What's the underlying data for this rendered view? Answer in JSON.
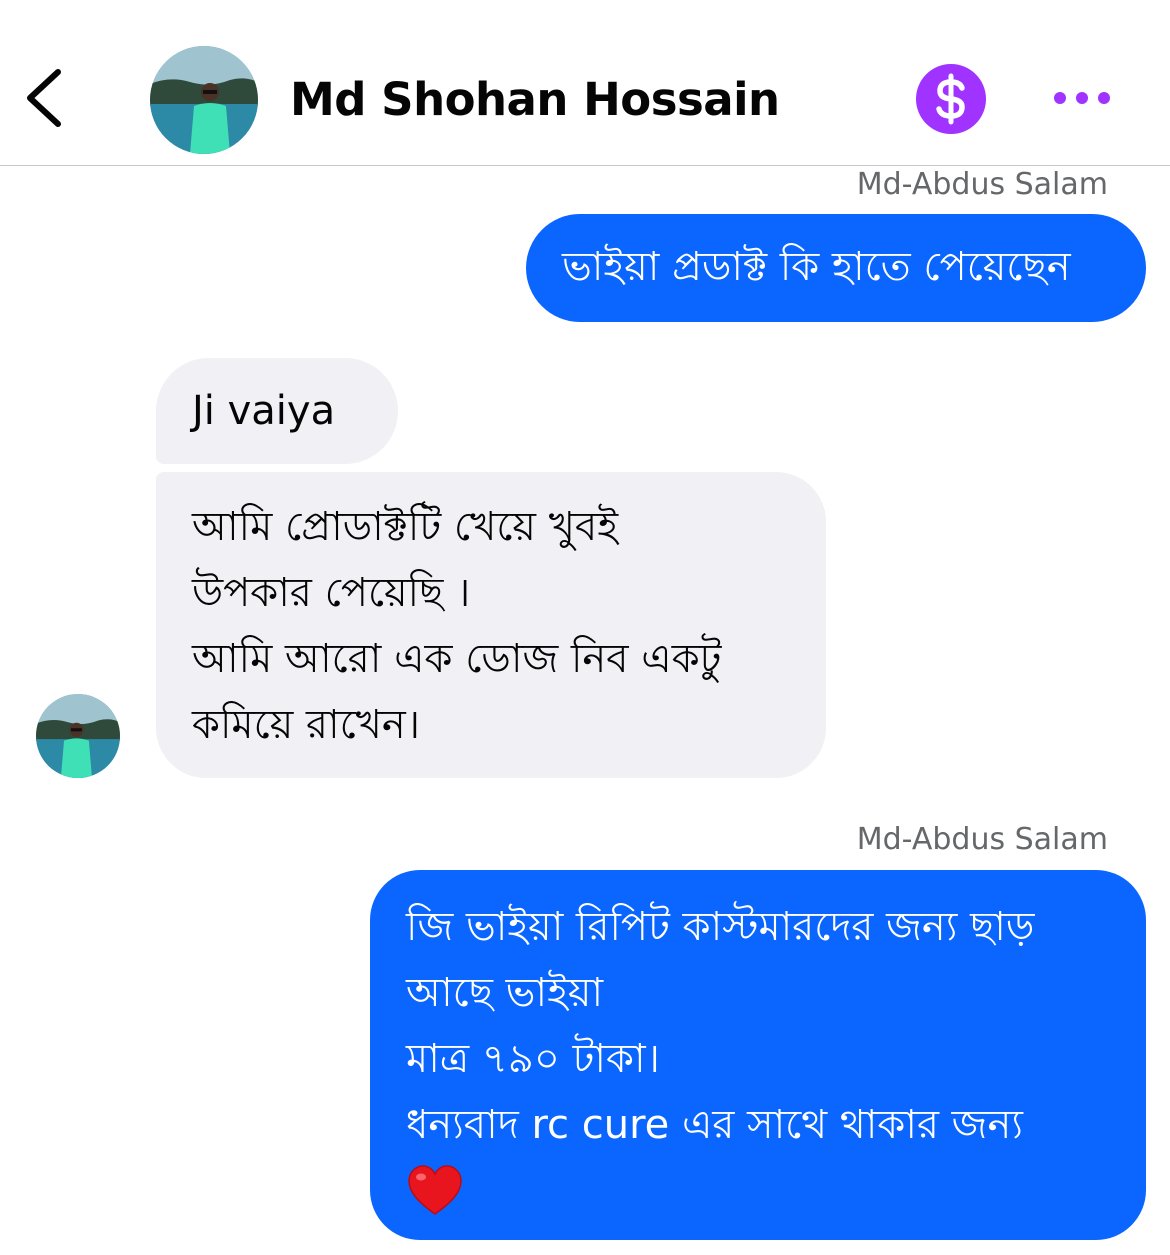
{
  "header": {
    "contact_name": "Md Shohan Hossain",
    "back_icon": "chevron-left-icon",
    "pay_icon": "dollar-sign-icon",
    "more_icon": "more-dots-icon",
    "pay_color": "#a033ff",
    "accent_color": "#a033ff"
  },
  "messages": [
    {
      "direction": "outgoing",
      "sender": "Md-Abdus Salam",
      "lines": [
        "ভাইয়া প্রডাক্ট কি হাতে পেয়েছেন"
      ]
    },
    {
      "direction": "incoming",
      "lines": [
        "Ji vaiya"
      ]
    },
    {
      "direction": "incoming",
      "lines": [
        "আমি প্রোডাক্টটি খেয়ে খুবই",
        "উপকার পেয়েছি ।",
        "আমি আরো এক ডোজ নিব একটু",
        "কমিয়ে রাখেন।"
      ]
    },
    {
      "direction": "outgoing",
      "sender": "Md-Abdus Salam",
      "lines": [
        "জি ভাইয়া রিপিট কাস্টমারদের জন্য ছাড়",
        "আছে ভাইয়া",
        "মাত্র ৭৯০ টাকা।",
        "ধন্যবাদ rc cure এর সাথে থাকার জন্য"
      ],
      "emoji": "heart-emoji"
    }
  ],
  "colors": {
    "outgoing_bubble": "#0a66ff",
    "incoming_bubble": "#f0f0f5",
    "sender_label": "#65676b"
  }
}
